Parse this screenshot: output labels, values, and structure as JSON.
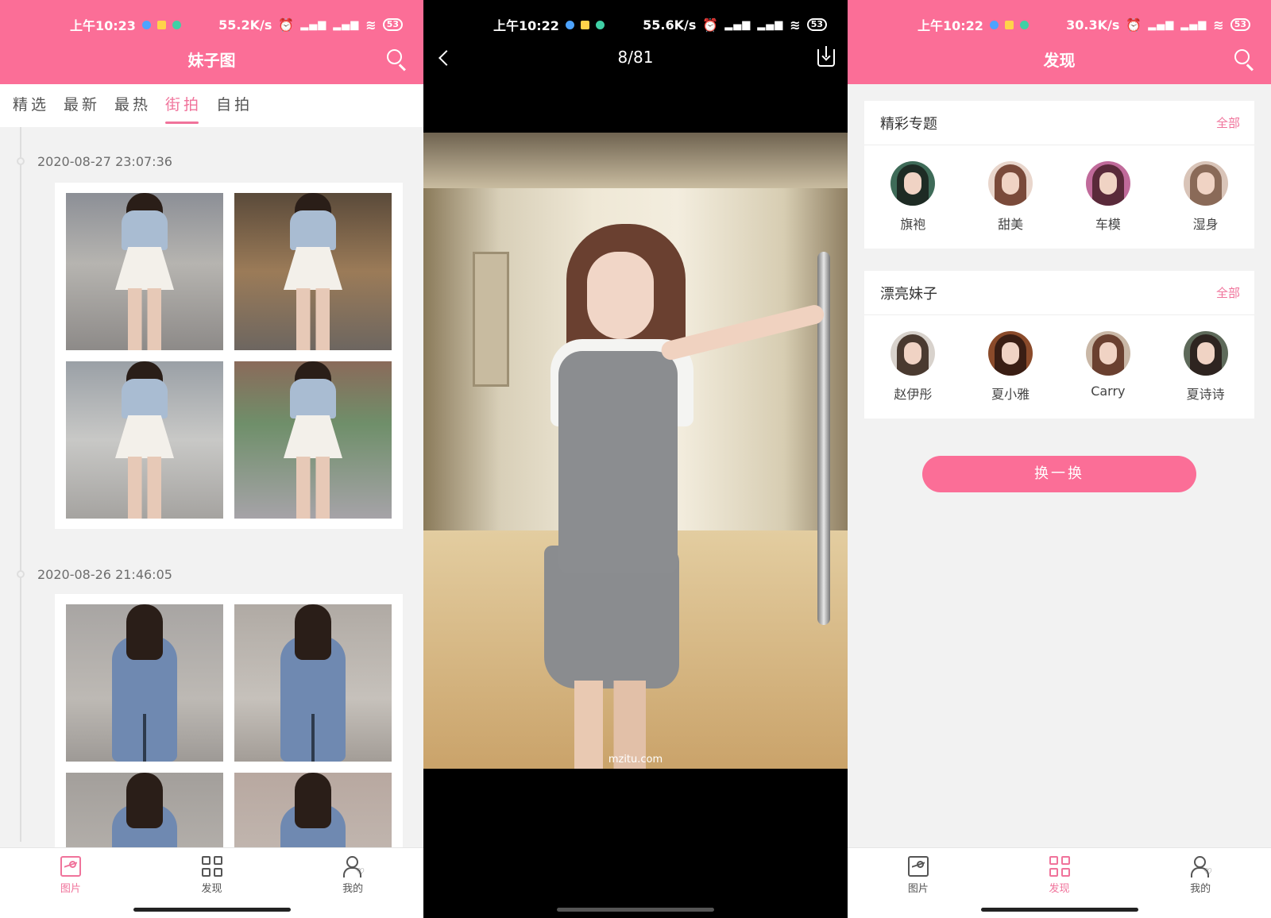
{
  "screen_gallery": {
    "status": {
      "time": "上午10:23",
      "speed": "55.2K/s",
      "battery": "53"
    },
    "title": "妹子图",
    "tabs": [
      "精选",
      "最新",
      "最热",
      "街拍",
      "自拍"
    ],
    "active_tab": "街拍",
    "posts": [
      {
        "date": "2020-08-27 23:07:36",
        "photos": [
          "street-photo-white-skirt-1",
          "street-photo-white-skirt-2",
          "street-photo-white-skirt-3",
          "street-photo-white-skirt-4"
        ]
      },
      {
        "date": "2020-08-26 21:46:05",
        "photos": [
          "street-photo-blue-dress-1",
          "street-photo-blue-dress-2",
          "street-photo-blue-dress-3",
          "street-photo-blue-dress-4"
        ]
      }
    ]
  },
  "screen_viewer": {
    "status": {
      "time": "上午10:22",
      "speed": "55.6K/s",
      "battery": "53"
    },
    "counter": "8/81",
    "watermark": "mzitu.com"
  },
  "screen_discover": {
    "status": {
      "time": "上午10:22",
      "speed": "30.3K/s",
      "battery": "53"
    },
    "title": "发现",
    "topics": {
      "title": "精彩专题",
      "all_label": "全部",
      "items": [
        {
          "name": "旗袍",
          "hair": "#1e2b24"
        },
        {
          "name": "甜美",
          "hair": "#7a4a3a"
        },
        {
          "name": "车模",
          "hair": "#5a2a3a"
        },
        {
          "name": "湿身",
          "hair": "#8a6a58"
        }
      ]
    },
    "girls": {
      "title": "漂亮妹子",
      "all_label": "全部",
      "items": [
        {
          "name": "赵伊彤",
          "hair": "#4a3a30"
        },
        {
          "name": "夏小雅",
          "hair": "#3a1e14"
        },
        {
          "name": "Carry",
          "hair": "#6a4030"
        },
        {
          "name": "夏诗诗",
          "hair": "#2e2420"
        }
      ]
    },
    "shuffle_label": "换一换"
  },
  "bottom_nav": {
    "items": [
      "图片",
      "发现",
      "我的"
    ]
  },
  "colors": {
    "accent": "#fb6e97",
    "accent_text": "#f0739b",
    "background": "#f2f2f2"
  }
}
